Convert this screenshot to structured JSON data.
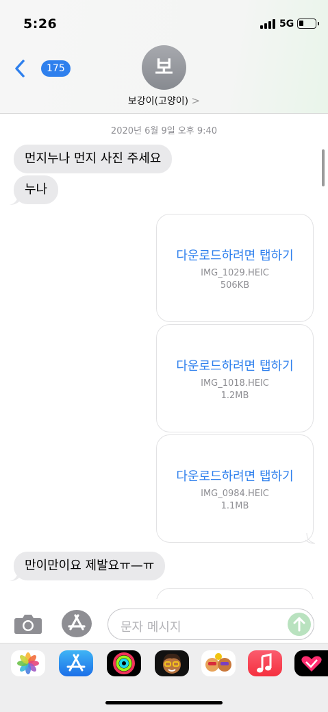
{
  "status_bar": {
    "time": "5:26",
    "network": "5G"
  },
  "header": {
    "back_count": "175",
    "avatar_initial": "보",
    "contact_name": "보강이(고양이)",
    "name_chevron": ">"
  },
  "thread": {
    "timestamp": "2020년 6월 9일 오후 9:40",
    "incoming": [
      {
        "text": "먼지누나 먼지  사진  주세요"
      },
      {
        "text": "누나"
      },
      {
        "text": "만이만이요 제발요ㅠ—ㅠ"
      }
    ],
    "attachments": [
      {
        "action": "다운로드하려면 탭하기",
        "filename": "IMG_1029.HEIC",
        "size": "506KB"
      },
      {
        "action": "다운로드하려면 탭하기",
        "filename": "IMG_1018.HEIC",
        "size": "1.2MB"
      },
      {
        "action": "다운로드하려면 탭하기",
        "filename": "IMG_0984.HEIC",
        "size": "1.1MB"
      }
    ]
  },
  "input": {
    "placeholder": "문자 메시지"
  },
  "app_drawer": {
    "apps": [
      "photos-icon",
      "app-store-icon",
      "activity-icon",
      "memoji-icon",
      "memoji-stickers-icon",
      "music-icon",
      "heart-app-icon"
    ]
  },
  "colors": {
    "accent": "#2f80ed",
    "bubble_in": "#e9e9eb",
    "send": "#b9e2bf"
  }
}
